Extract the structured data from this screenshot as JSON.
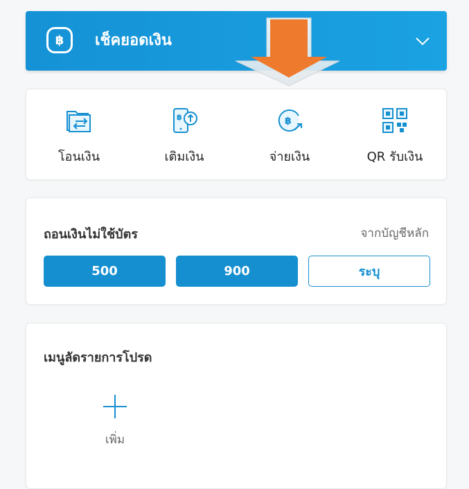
{
  "balance": {
    "label": "เช็คยอดเงิน",
    "currency_symbol": "฿",
    "icon": "baht-badge-icon"
  },
  "quick_actions": [
    {
      "label": "โอนเงิน",
      "icon": "transfer-icon"
    },
    {
      "label": "เติมเงิน",
      "icon": "topup-icon"
    },
    {
      "label": "จ่ายเงิน",
      "icon": "pay-icon"
    },
    {
      "label": "QR รับเงิน",
      "icon": "qr-icon"
    }
  ],
  "cardless": {
    "title": "ถอนเงินไม่ใช้บัตร",
    "source": "จากบัญชีหลัก",
    "amounts": [
      "500",
      "900"
    ],
    "specify_label": "ระบุ"
  },
  "favorites": {
    "title": "เมนูลัดรายการโปรด",
    "add_label": "เพิ่ม"
  },
  "colors": {
    "primary": "#158fd0",
    "arrow": "#ee7a2d"
  }
}
